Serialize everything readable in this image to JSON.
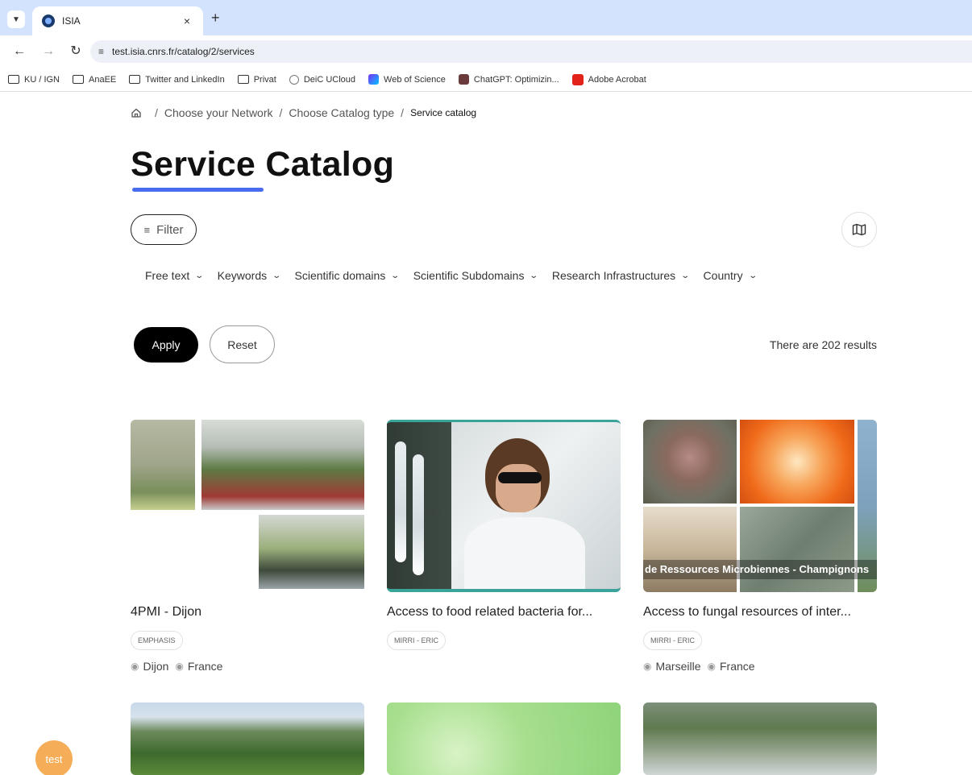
{
  "browser": {
    "tab_title": "ISIA",
    "tab_close": "×",
    "new_tab": "+",
    "url": "test.isia.cnrs.fr/catalog/2/services",
    "bookmarks": [
      {
        "label": "KU / IGN",
        "icon": "folder-icon"
      },
      {
        "label": "AnaEE",
        "icon": "folder-icon"
      },
      {
        "label": "Twitter and LinkedIn",
        "icon": "folder-icon"
      },
      {
        "label": "Privat",
        "icon": "folder-icon"
      },
      {
        "label": "DeiC UCloud",
        "icon": "deic-icon"
      },
      {
        "label": "Web of Science",
        "icon": "web-of-science-icon"
      },
      {
        "label": "ChatGPT: Optimizin...",
        "icon": "chatgpt-icon"
      },
      {
        "label": "Adobe Acrobat",
        "icon": "adobe-acrobat-icon"
      }
    ]
  },
  "breadcrumb": {
    "items": [
      "Choose your Network",
      "Choose Catalog type"
    ],
    "current": "Service catalog",
    "separator": "/"
  },
  "page": {
    "title": "Service Catalog",
    "accent_color": "#4a6cf0"
  },
  "toolbar": {
    "filter_label": "Filter",
    "apply_label": "Apply",
    "reset_label": "Reset",
    "results_text": "There are 202 results"
  },
  "filters": [
    {
      "label": "Free text"
    },
    {
      "label": "Keywords"
    },
    {
      "label": "Scientific domains"
    },
    {
      "label": "Scientific Subdomains"
    },
    {
      "label": "Research Infrastructures"
    },
    {
      "label": "Country"
    }
  ],
  "cards": [
    {
      "title": "4PMI - Dijon",
      "badge": "EMPHASIS",
      "city": "Dijon",
      "country": "France"
    },
    {
      "title": "Access to food related bacteria for...",
      "badge": "MIRRI - ERIC",
      "city": "",
      "country": ""
    },
    {
      "title": "Access to fungal resources of inter...",
      "badge": "MIRRI - ERIC",
      "city": "Marseille",
      "country": "France",
      "image_caption": "de Ressources Microbiennes - Champignons"
    }
  ],
  "floating_badge": "test"
}
